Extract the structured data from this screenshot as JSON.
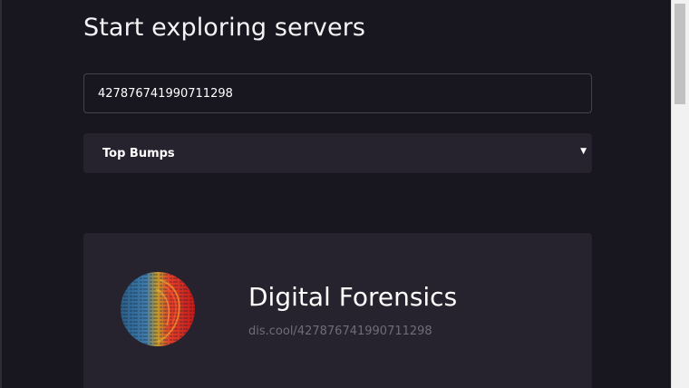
{
  "header": {
    "title": "Start exploring servers"
  },
  "search": {
    "value": "427876741990711298"
  },
  "sort": {
    "selected": "Top Bumps"
  },
  "icons": {
    "dropdown": "caret-down-icon"
  },
  "server": {
    "name": "Digital Forensics",
    "link": "dis.cool/427876741990711298"
  },
  "colors": {
    "background": "#18171f",
    "card": "#27232e",
    "input_border": "#44434c",
    "muted_text": "#6e6c78"
  }
}
